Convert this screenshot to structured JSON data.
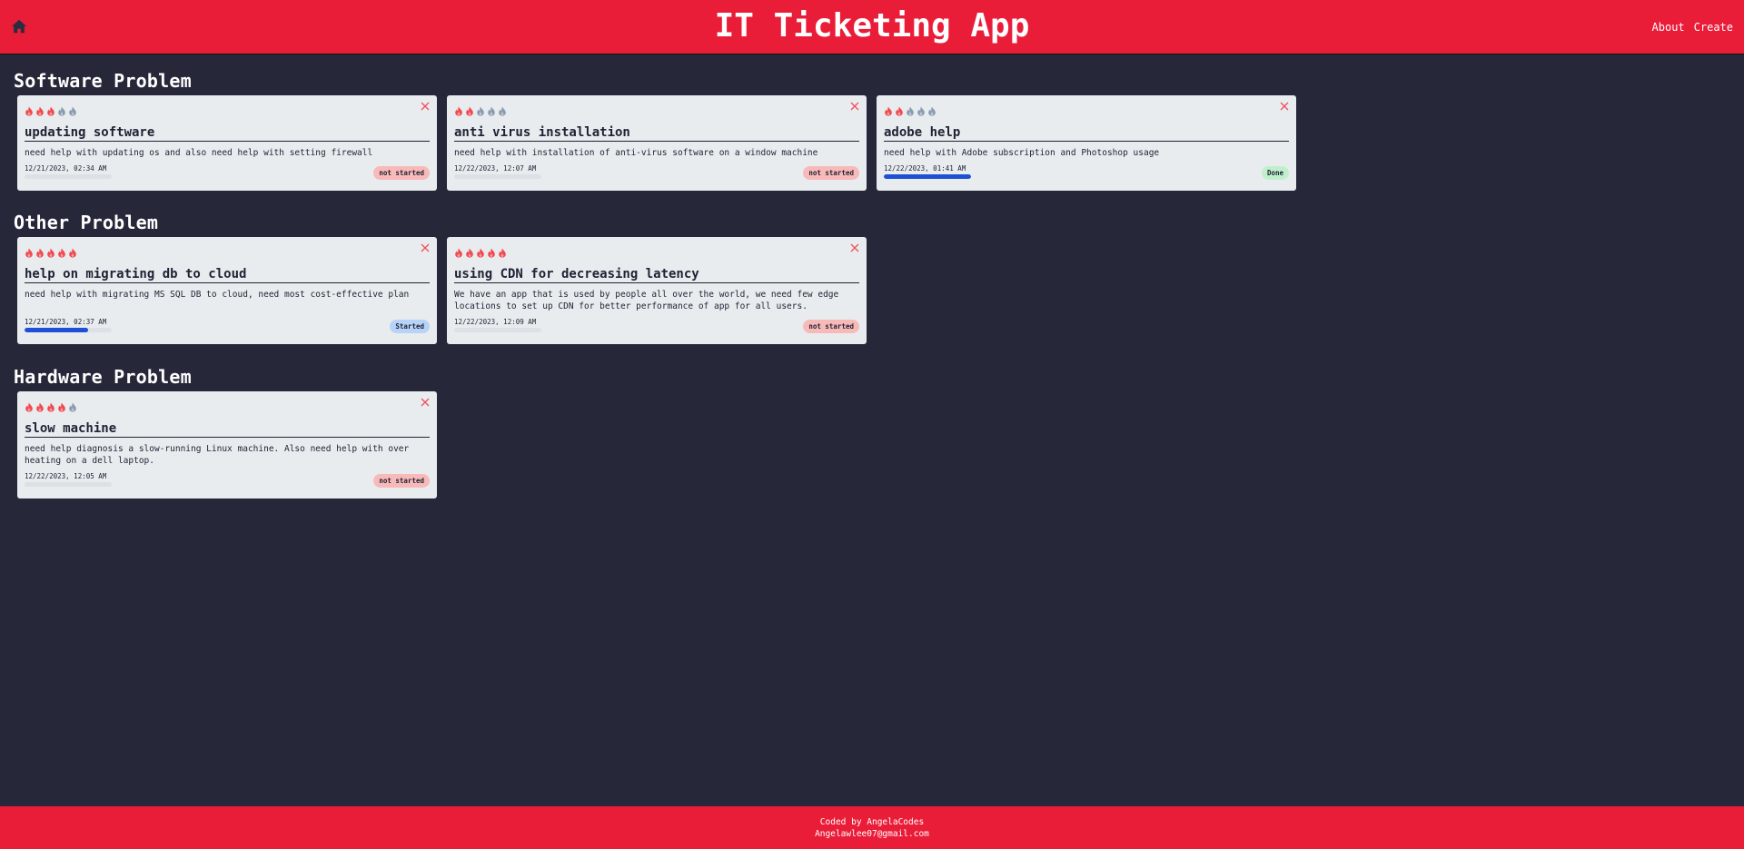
{
  "app": {
    "title": "IT Ticketing App"
  },
  "nav": {
    "links": [
      "About",
      "Create"
    ]
  },
  "colors": {
    "brand": "#ea1d39",
    "background": "#262839",
    "card": "#e8ecef",
    "flame_active": "#f3484f",
    "flame_inactive": "#8a9bb0",
    "progress": "#1e4fd6",
    "status_not_started": "#f8b9b9",
    "status_started": "#b7d3f7",
    "status_done": "#bff0cb"
  },
  "sections": [
    {
      "title": "Software Problem",
      "tickets": [
        {
          "title": "updating software",
          "description": "need help with updating os and also need help with setting firewall",
          "date": "12/21/2023, 02:34 AM",
          "priority": 3,
          "progress": 0,
          "status": "not started",
          "status_color": "#f8b9b9"
        },
        {
          "title": "anti virus installation",
          "description": "need help with installation of anti-virus software on a window machine",
          "date": "12/22/2023, 12:07 AM",
          "priority": 2,
          "progress": 0,
          "status": "not started",
          "status_color": "#f8b9b9"
        },
        {
          "title": "adobe help",
          "description": "need help with Adobe subscription and Photoshop usage",
          "date": "12/22/2023, 01:41 AM",
          "priority": 2,
          "progress": 1.0,
          "status": "Done",
          "status_color": "#bff0cb"
        }
      ]
    },
    {
      "title": "Other Problem",
      "tickets": [
        {
          "title": "help on migrating db to cloud",
          "description": "need help with migrating MS SQL DB to cloud, need most cost-effective plan",
          "date": "12/21/2023, 02:37 AM",
          "priority": 5,
          "progress": 0.73,
          "status": "Started",
          "status_color": "#b7d3f7"
        },
        {
          "title": "using CDN for decreasing latency",
          "description": "We have an app that is used by people all over the world, we need few edge locations to set up CDN for better performance of app for all users.",
          "date": "12/22/2023, 12:09 AM",
          "priority": 5,
          "progress": 0,
          "status": "not started",
          "status_color": "#f8b9b9"
        }
      ]
    },
    {
      "title": "Hardware Problem",
      "tickets": [
        {
          "title": "slow machine",
          "description": "need help diagnosis a slow-running Linux machine. Also need help with over heating on a dell laptop.",
          "date": "12/22/2023, 12:05 AM",
          "priority": 4,
          "progress": 0,
          "status": "not started",
          "status_color": "#f8b9b9"
        }
      ]
    }
  ],
  "footer": {
    "line1": "Coded by AngelaCodes",
    "line2": "Angelawlee07@gmail.com"
  }
}
